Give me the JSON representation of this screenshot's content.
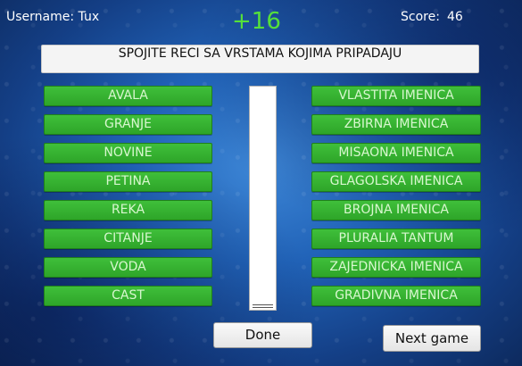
{
  "header": {
    "username": "Username: Tux",
    "points_delta": "+16",
    "score_label": "Score:",
    "score_value": "46"
  },
  "instruction": "SPOJITE RECI SA VRSTAMA KOJIMA PRIPADAJU",
  "words": [
    "AVALA",
    "GRANJE",
    "NOVINE",
    "PETINA",
    "REKA",
    "CITANJE",
    "VODA",
    "CAST"
  ],
  "categories": [
    "VLASTITA IMENICA",
    "ZBIRNA IMENICA",
    "MISAONA IMENICA",
    "GLAGOLSKA IMENICA",
    "BROJNA IMENICA",
    "PLURALIA TANTUM",
    "ZAJEDNICKA IMENICA",
    "GRADIVNA IMENICA"
  ],
  "buttons": {
    "done": "Done",
    "next_game": "Next game"
  },
  "colors": {
    "word_button": "#2ea529",
    "delta_text": "#55e03a",
    "background": "#2163b8"
  }
}
